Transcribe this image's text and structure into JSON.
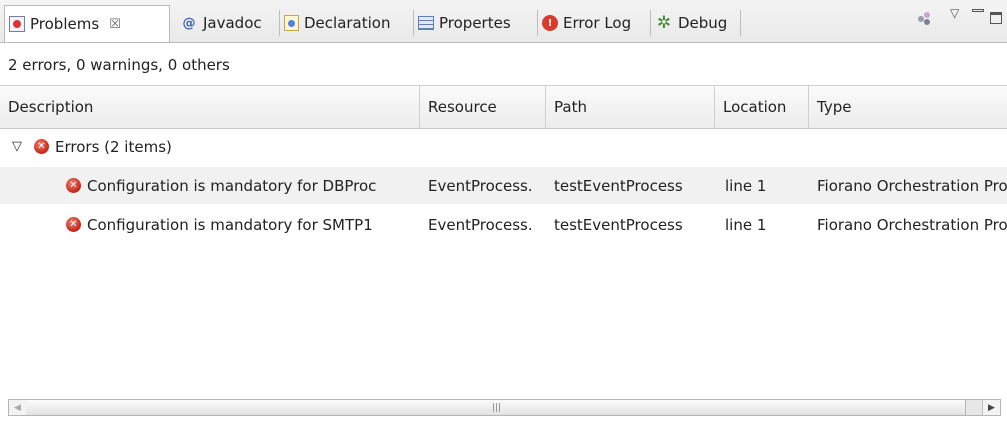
{
  "tabs": [
    {
      "label": "Problems",
      "icon": "problems-icon",
      "active": true,
      "close": "☒"
    },
    {
      "label": "Javadoc",
      "icon": "javadoc-icon"
    },
    {
      "label": "Declaration",
      "icon": "declaration-icon"
    },
    {
      "label": "Propertes",
      "icon": "properties-icon"
    },
    {
      "label": "Error Log",
      "icon": "error-log-icon"
    },
    {
      "label": "Debug",
      "icon": "debug-icon"
    }
  ],
  "toolbar": {
    "view_menu": "▽",
    "minimize": "minimize",
    "maximize": "maximize"
  },
  "status": "2 errors, 0 warnings, 0 others",
  "columns": [
    "Description",
    "Resource",
    "Path",
    "Location",
    "Type"
  ],
  "group": {
    "label": "Errors (2 items)",
    "expanded": true
  },
  "errors": [
    {
      "description": "Configuration is mandatory for DBProc",
      "resource": "EventProcess.",
      "path": "testEventProcess",
      "location": "line 1",
      "type": "Fiorano Orchestration Problem"
    },
    {
      "description": "Configuration is mandatory for SMTP1",
      "resource": "EventProcess.",
      "path": "testEventProcess",
      "location": "line 1",
      "type": "Fiorano Orchestration Problem"
    }
  ],
  "colors": {
    "error_red": "#c42414",
    "alt_row": "#f1f1f1",
    "header_bg": "#ececec"
  }
}
